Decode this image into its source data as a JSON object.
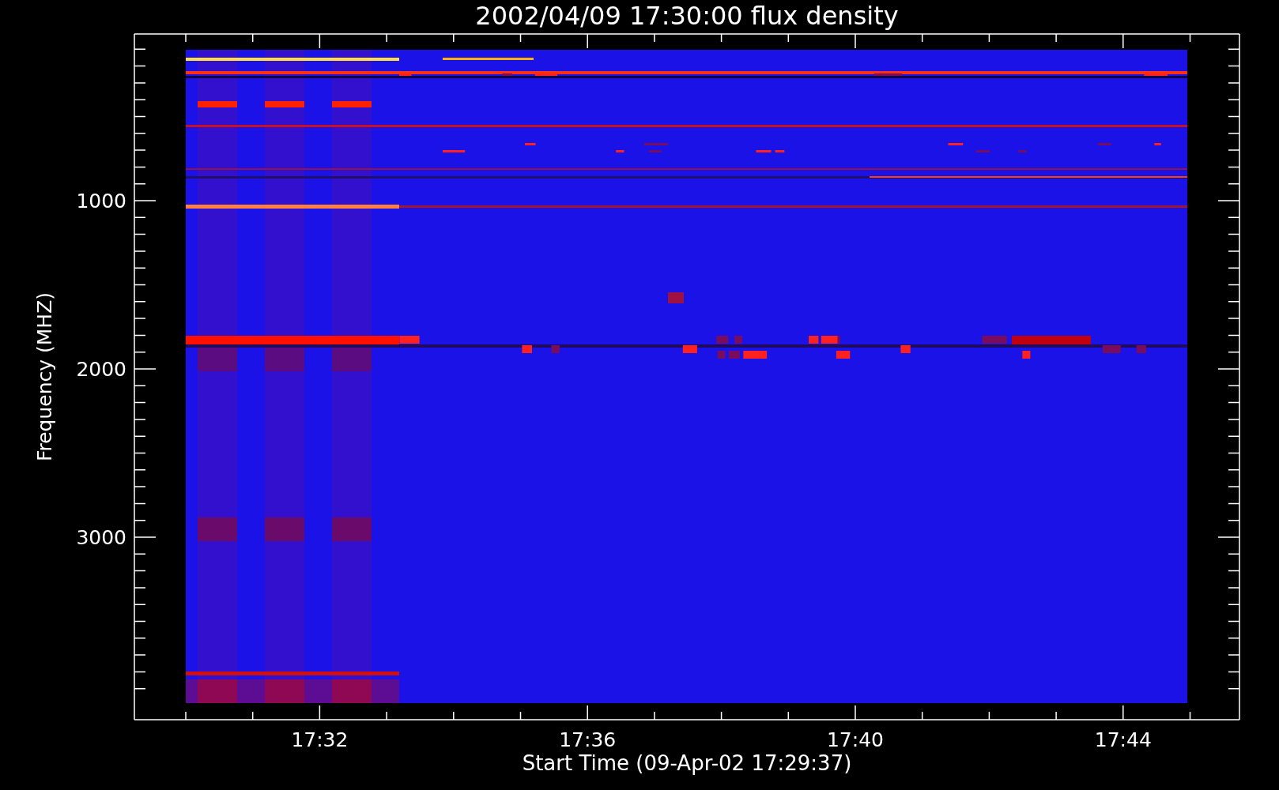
{
  "title": "2002/04/09 17:30:00 flux density",
  "y_axis": {
    "label": "Frequency (MHZ)",
    "ticks": [
      "1000",
      "2000",
      "3000"
    ]
  },
  "x_axis": {
    "label": "Start Time (09-Apr-02 17:29:37)",
    "ticks": [
      "17:32",
      "17:36",
      "17:40",
      "17:44"
    ]
  }
}
